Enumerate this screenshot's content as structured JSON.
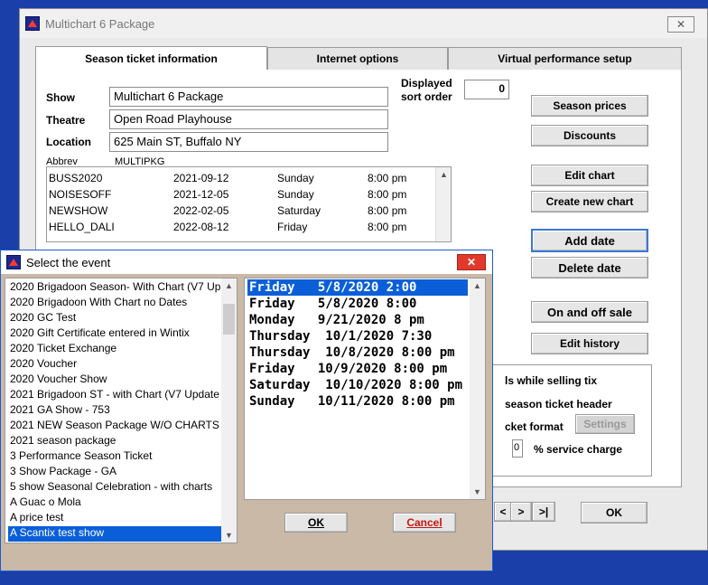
{
  "main_window": {
    "title": "Multichart 6 Package",
    "close_glyph": "✕",
    "tabs": [
      "Season ticket information",
      "Internet options",
      "Virtual performance setup"
    ],
    "show_label": "Show",
    "show_value": "Multichart 6 Package",
    "theatre_label": "Theatre",
    "theatre_value": "Open Road Playhouse",
    "location_label": "Location",
    "location_value": "625 Main ST, Buffalo NY",
    "abbrev_label": "Abbrev",
    "abbrev_value": "MULTIPKG",
    "sort_label_1": "Displayed",
    "sort_label_2": "sort order",
    "sort_value": "0",
    "performances": [
      {
        "code": "BUSS2020",
        "date": "2021-09-12",
        "day": "Sunday",
        "time": "8:00 pm"
      },
      {
        "code": "NOISESOFF",
        "date": "2021-12-05",
        "day": "Sunday",
        "time": "8:00 pm"
      },
      {
        "code": "NEWSHOW",
        "date": "2022-02-05",
        "day": "Saturday",
        "time": "8:00 pm"
      },
      {
        "code": "HELLO_DALI",
        "date": "2022-08-12",
        "day": "Friday",
        "time": "8:00 pm"
      }
    ],
    "buttons": {
      "season_prices": "Season prices",
      "discounts": "Discounts",
      "edit_chart": "Edit chart",
      "create_new_chart": "Create new chart",
      "add_date": "Add  date",
      "delete_date": "Delete date",
      "on_off_sale": "On and off sale",
      "edit_history": "Edit history",
      "settings": "Settings",
      "nav_prev": "<",
      "nav_next": ">",
      "nav_last": ">|",
      "ok": "OK"
    },
    "options": {
      "line1": "ls while selling tix",
      "line2": "season ticket header",
      "line3": "cket format",
      "service_value": "0",
      "service_label": "% service charge"
    }
  },
  "dialog": {
    "title": "Select the event",
    "close_glyph": "✕",
    "events": [
      "2020 Brigadoon Season- With Chart (V7 Up",
      "2020 Brigadoon With Chart no Dates",
      "2020 GC Test",
      "2020 Gift Certificate entered in Wintix",
      "2020 Ticket Exchange",
      "2020 Voucher",
      "2020 Voucher Show",
      "2021 Brigadoon ST - with Chart (V7 Update",
      "2021 GA Show - 753",
      "2021 NEW Season Package W/O CHARTS",
      "2021 season package",
      "3 Performance Season Ticket",
      "3 Show Package - GA",
      "5 show Seasonal Celebration - with charts",
      "A Guac o Mola",
      "A price test",
      "A Scantix test show"
    ],
    "dates": [
      "Friday   5/8/2020 2:00",
      "Friday   5/8/2020 8:00",
      "Monday   9/21/2020 8 pm",
      "Thursday  10/1/2020 7:30",
      "Thursday  10/8/2020 8:00 pm",
      "Friday   10/9/2020 8:00 pm",
      "Saturday  10/10/2020 8:00 pm",
      "Sunday   10/11/2020 8:00 pm"
    ],
    "ok_label": "OK",
    "cancel_label": "Cancel"
  }
}
